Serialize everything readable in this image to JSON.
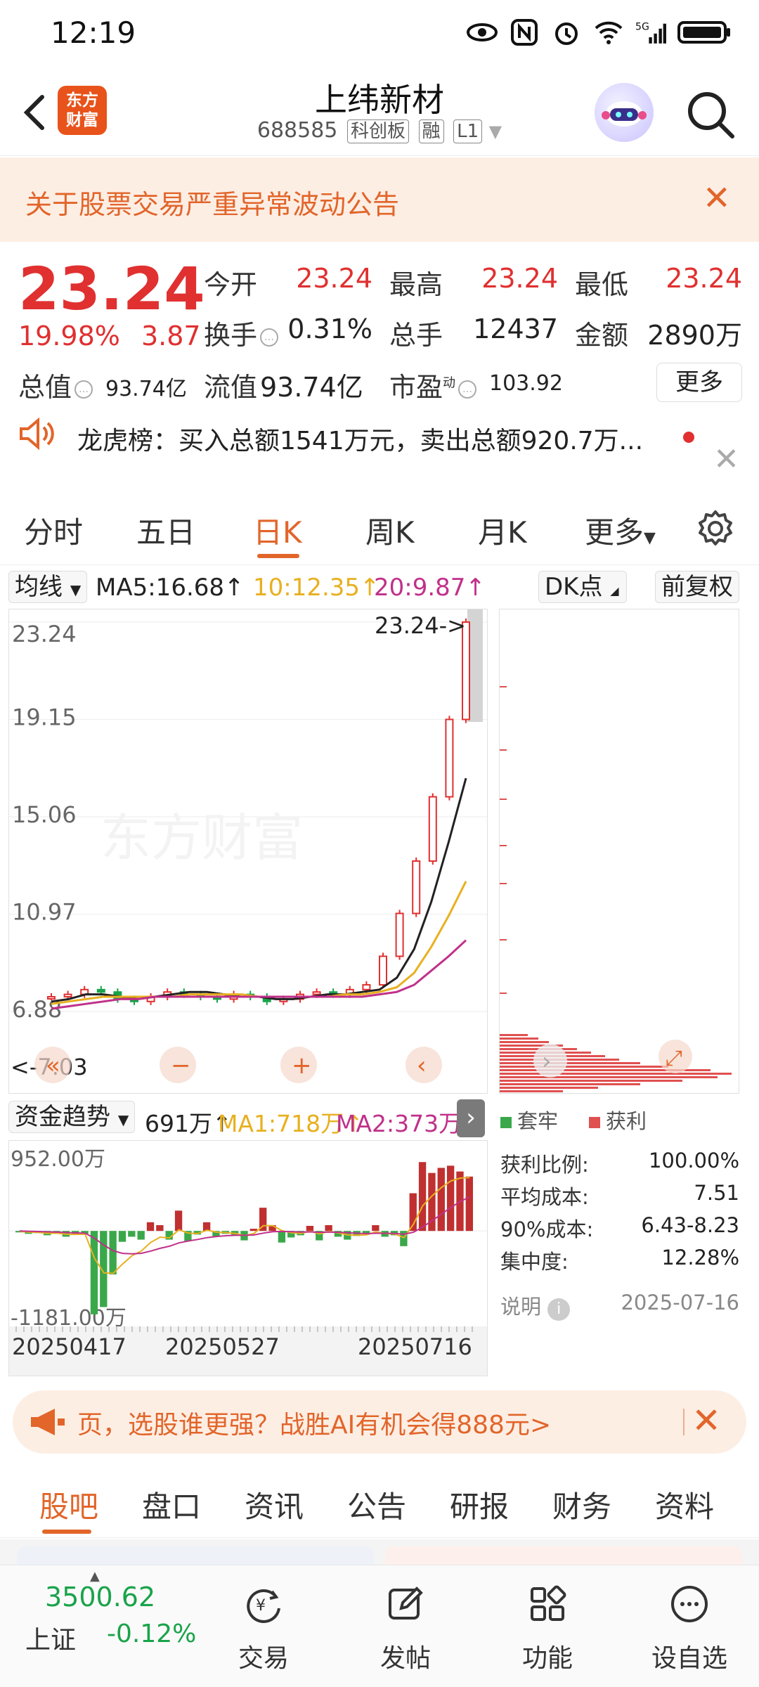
{
  "status": {
    "time": "12:19"
  },
  "header": {
    "logo_line1": "东方",
    "logo_line2": "财富",
    "title": "上纬新材",
    "code": "688585",
    "tags": [
      "科创板",
      "融",
      "L1"
    ]
  },
  "notice": {
    "text": "关于股票交易严重异常波动公告"
  },
  "quote": {
    "price": "23.24",
    "change_pct": "19.98%",
    "change": "3.87",
    "fields": [
      {
        "label": "今开",
        "value": "23.24"
      },
      {
        "label": "最高",
        "value": "23.24"
      },
      {
        "label": "最低",
        "value": "23.24"
      },
      {
        "label": "换手",
        "value": "0.31%"
      },
      {
        "label": "总手",
        "value": "12437"
      },
      {
        "label": "金额",
        "value": "2890万"
      },
      {
        "label": "总值",
        "value": "93.74亿"
      },
      {
        "label": "流值",
        "value": "93.74亿"
      },
      {
        "label": "市盈",
        "value": "103.92"
      }
    ],
    "pe_superscript": "动",
    "more_label": "更多"
  },
  "dragon": {
    "text": "龙虎榜：买入总额1541万元，卖出总额920.7万..."
  },
  "ktabs": [
    "分时",
    "五日",
    "日K",
    "周K",
    "月K",
    "更多"
  ],
  "ma": {
    "selector": "均线",
    "ma5": "MA5:16.68↑",
    "ma10": "10:12.35↑",
    "ma20": "20:9.87↑",
    "dk": "DK点",
    "adj": "前复权",
    "colors": {
      "ma5": "#222222",
      "ma10": "#e8b020",
      "ma20": "#c0308a",
      "up": "#e03030",
      "down": "#1aa34a"
    }
  },
  "chart_data": [
    {
      "type": "line",
      "title": "",
      "y_ticks": [
        "23.24",
        "19.15",
        "15.06",
        "10.97",
        "6.88"
      ],
      "ylim": [
        6.88,
        23.24
      ],
      "last_price_label": "23.24->",
      "low_label": "<-7.03",
      "series": [
        {
          "name": "MA5",
          "values": [
            7.3,
            7.4,
            7.6,
            7.6,
            7.5,
            7.4,
            7.5,
            7.6,
            7.7,
            7.7,
            7.6,
            7.5,
            7.5,
            7.4,
            7.4,
            7.5,
            7.6,
            7.6,
            7.7,
            7.8,
            8.3,
            9.5,
            11.5,
            14.0,
            16.68
          ]
        },
        {
          "name": "MA10",
          "values": [
            7.2,
            7.3,
            7.4,
            7.5,
            7.5,
            7.5,
            7.5,
            7.5,
            7.6,
            7.6,
            7.6,
            7.6,
            7.5,
            7.5,
            7.5,
            7.5,
            7.5,
            7.6,
            7.6,
            7.7,
            7.9,
            8.5,
            9.6,
            10.9,
            12.35
          ]
        },
        {
          "name": "MA20",
          "values": [
            7.0,
            7.1,
            7.2,
            7.3,
            7.4,
            7.4,
            7.5,
            7.5,
            7.5,
            7.5,
            7.5,
            7.5,
            7.5,
            7.5,
            7.5,
            7.5,
            7.5,
            7.5,
            7.5,
            7.6,
            7.7,
            8.0,
            8.6,
            9.2,
            9.87
          ]
        }
      ],
      "candles_close": [
        7.5,
        7.6,
        7.8,
        7.7,
        7.4,
        7.3,
        7.5,
        7.7,
        7.6,
        7.5,
        7.4,
        7.6,
        7.5,
        7.3,
        7.4,
        7.6,
        7.7,
        7.6,
        7.8,
        8.0,
        9.2,
        11.0,
        13.2,
        15.9,
        19.15,
        23.24
      ]
    },
    {
      "type": "bar",
      "title": "",
      "indicator": "资金趋势",
      "legend": [
        "691万↑",
        "MA1:718万↑",
        "MA2:373万↑"
      ],
      "y_top_label": "952.00万",
      "y_bottom_label": "-1181.00万",
      "ylim": [
        -1181,
        952
      ],
      "dates": [
        "20250417",
        "20250527",
        "20250716"
      ],
      "values": [
        -20,
        -40,
        -30,
        -60,
        -30,
        -80,
        -50,
        -40,
        -1150,
        -1050,
        -600,
        -150,
        -80,
        -120,
        120,
        80,
        -120,
        280,
        -140,
        -50,
        120,
        -80,
        -40,
        -60,
        -130,
        30,
        320,
        80,
        -160,
        -90,
        -60,
        70,
        -130,
        80,
        -80,
        -120,
        -70,
        -40,
        80,
        -80,
        -60,
        -210,
        520,
        950,
        800,
        870,
        900,
        820,
        750
      ]
    }
  ],
  "chip": {
    "legend_trapped": "套牢",
    "legend_profit": "获利",
    "rows": [
      {
        "label": "获利比例:",
        "value": "100.00%"
      },
      {
        "label": "平均成本:",
        "value": "7.51"
      },
      {
        "label": "90%成本:",
        "value": "6.43-8.23"
      },
      {
        "label": "集中度:",
        "value": "12.28%"
      }
    ],
    "note": "说明",
    "date": "2025-07-16"
  },
  "promo": {
    "text": "页，选股谁更强？战胜AI有机会得888元>"
  },
  "btabs": [
    "股吧",
    "盘口",
    "资讯",
    "公告",
    "研报",
    "财务",
    "资料"
  ],
  "index": {
    "value": "3500.62",
    "name": "上证",
    "change": "-0.12%"
  },
  "nav": [
    "交易",
    "发帖",
    "功能",
    "设自选"
  ]
}
